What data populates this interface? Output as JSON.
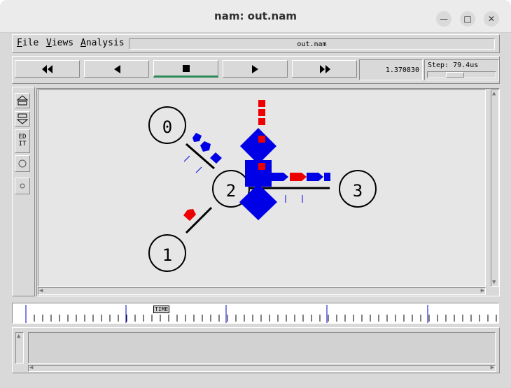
{
  "window": {
    "title": "nam: out.nam",
    "minimize_icon": "minimize-icon",
    "maximize_icon": "maximize-icon",
    "close_icon": "close-icon"
  },
  "menubar": {
    "file": "File",
    "views": "Views",
    "analysis": "Analysis",
    "filename": "out.nam"
  },
  "player": {
    "rewind_icon": "fast-rewind-icon",
    "back_icon": "play-backward-icon",
    "stop_icon": "stop-icon",
    "play_icon": "play-forward-icon",
    "forward_icon": "fast-forward-icon",
    "current_time": "1.370830",
    "step_label": "Step: 79.4us"
  },
  "tools": [
    "zoom-in-icon",
    "zoom-out-icon",
    "edit-tool",
    "circle-tool",
    "small-circle-tool"
  ],
  "edit_label": "ED\nIT",
  "nodes": [
    {
      "id": "0",
      "label": "0"
    },
    {
      "id": "1",
      "label": "1"
    },
    {
      "id": "2",
      "label": "2"
    },
    {
      "id": "3",
      "label": "3"
    }
  ],
  "timeline": {
    "label": "TIME"
  },
  "colors": {
    "packet_blue": "#0000e6",
    "packet_red": "#ee0000",
    "node_stroke": "#000000",
    "canvas_bg": "#e6e6e6"
  }
}
